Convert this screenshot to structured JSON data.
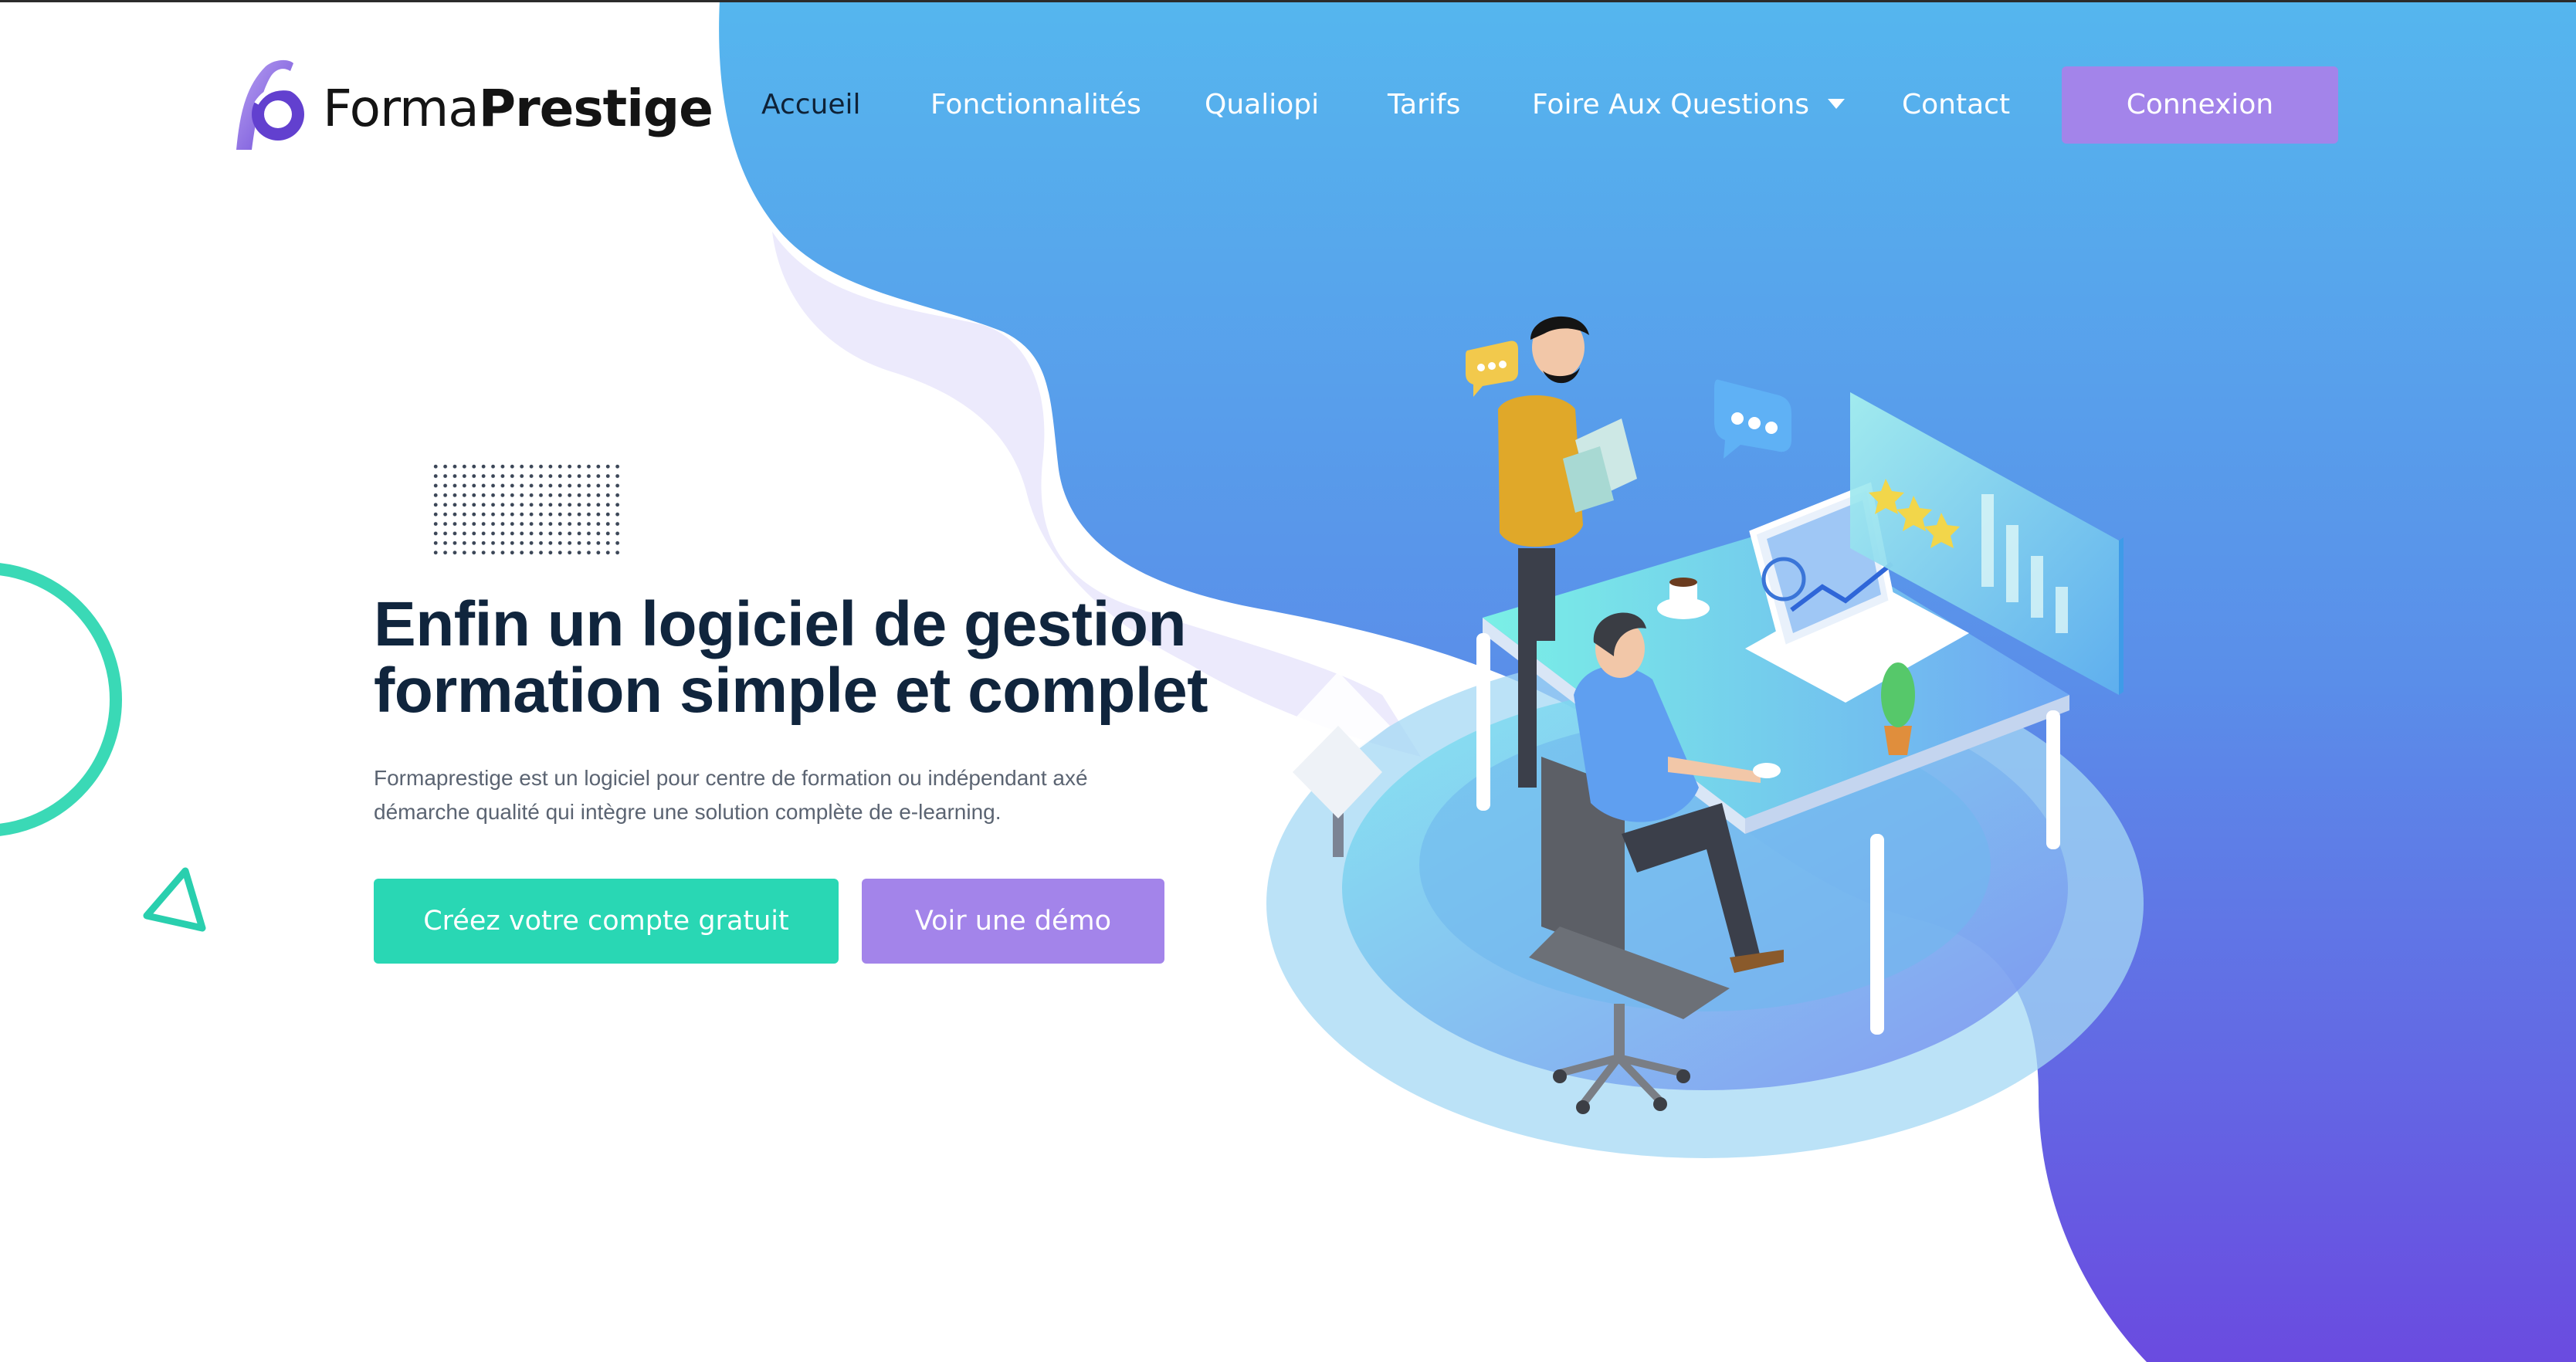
{
  "brand": {
    "name_light": "Forma",
    "name_bold": "Prestige"
  },
  "nav": {
    "items": [
      {
        "label": "Accueil",
        "active": true
      },
      {
        "label": "Fonctionnalités",
        "active": false
      },
      {
        "label": "Qualiopi",
        "active": false
      },
      {
        "label": "Tarifs",
        "active": false
      },
      {
        "label": "Foire Aux Questions",
        "active": false,
        "has_dropdown": true
      },
      {
        "label": "Contact",
        "active": false
      }
    ],
    "login_label": "Connexion"
  },
  "hero": {
    "title_line1": "Enfin un logiciel de gestion",
    "title_line2": "formation simple et complet",
    "description_line1": "Formaprestige est un logiciel pour centre de formation ou indépendant axé",
    "description_line2": "démarche qualité qui intègre une solution complète de e-learning.",
    "cta_primary": "Créez votre compte gratuit",
    "cta_secondary": "Voir une démo"
  },
  "colors": {
    "accent_green": "#29d7b4",
    "accent_purple": "#a384ea",
    "blob_top": "#55b4ee",
    "blob_bottom": "#6a4fe0",
    "heading": "#10253d"
  }
}
